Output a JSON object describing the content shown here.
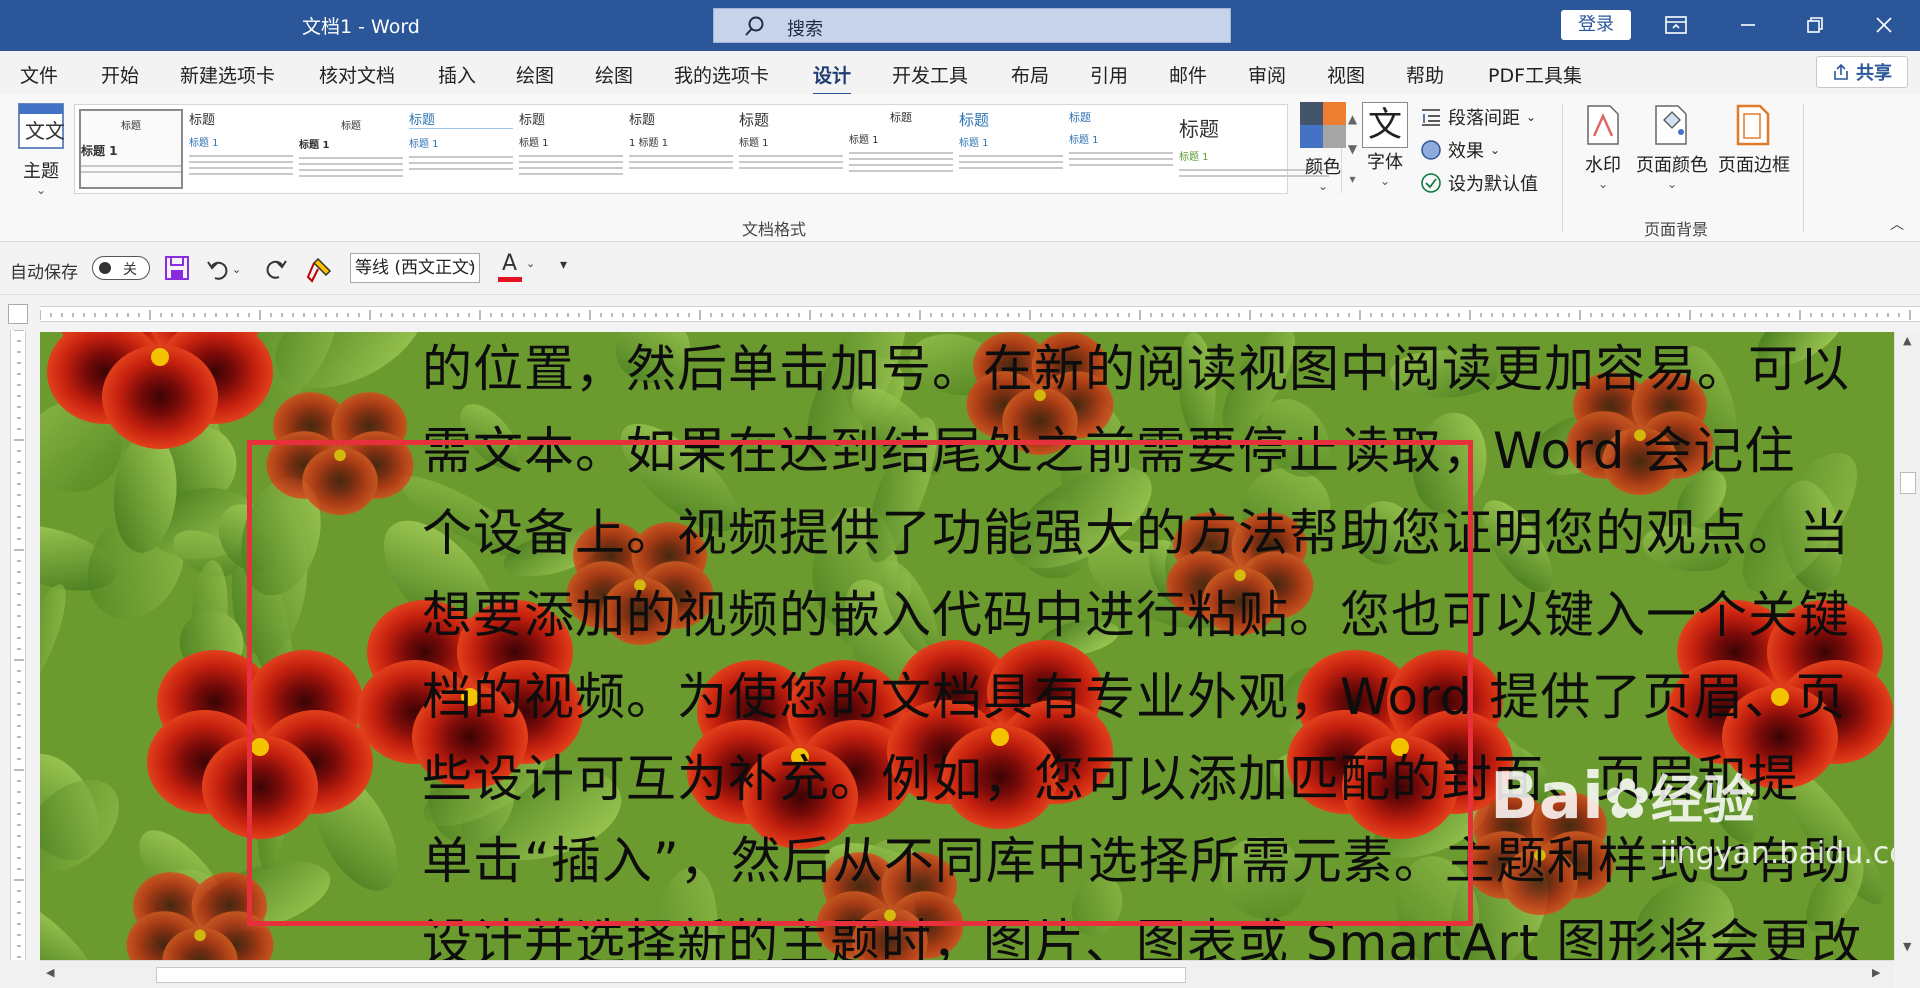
{
  "window": {
    "title": "文档1 - Word",
    "search_placeholder": "搜索",
    "login_label": "登录"
  },
  "tabs": [
    {
      "label": "文件"
    },
    {
      "label": "开始"
    },
    {
      "label": "新建选项卡"
    },
    {
      "label": "核对文档"
    },
    {
      "label": "插入"
    },
    {
      "label": "绘图"
    },
    {
      "label": "绘图"
    },
    {
      "label": "我的选项卡"
    },
    {
      "label": "设计",
      "active": true
    },
    {
      "label": "开发工具"
    },
    {
      "label": "布局"
    },
    {
      "label": "引用"
    },
    {
      "label": "邮件"
    },
    {
      "label": "审阅"
    },
    {
      "label": "视图"
    },
    {
      "label": "帮助"
    },
    {
      "label": "PDF工具集"
    }
  ],
  "share_label": "共享",
  "ribbon": {
    "theme_label": "主题",
    "gallery_items": [
      {
        "heading": "标题",
        "sub": "标题 1"
      },
      {
        "heading": "标题",
        "sub": "标题 1"
      },
      {
        "heading": "标题",
        "sub": "标题 1"
      },
      {
        "heading": "标题",
        "sub": "标题 1"
      },
      {
        "heading": "标题",
        "sub": "标题 1"
      },
      {
        "heading": "标题",
        "sub": "1 标题 1"
      },
      {
        "heading": "标题",
        "sub": "标题 1"
      },
      {
        "heading": "标题",
        "sub": "标题 1"
      },
      {
        "heading": "标题",
        "sub": "标题 1"
      },
      {
        "heading": "标题",
        "sub": "标题 1"
      },
      {
        "heading": "标题",
        "sub": "标题 1"
      }
    ],
    "doc_format_label": "文档格式",
    "colors_label": "颜色",
    "fonts_label": "字体",
    "para_spacing_label": "段落间距",
    "effects_label": "效果",
    "set_default_label": "设为默认值",
    "watermark_label": "水印",
    "page_color_label": "页面颜色",
    "page_border_label": "页面边框",
    "page_background_label": "页面背景"
  },
  "qat": {
    "autosave_label": "自动保存",
    "autosave_state": "关",
    "font_name": "等线 (西文正文)",
    "font_color_letter": "A"
  },
  "document": {
    "lines": [
      "的位置，然后单击加号。在新的阅读视图中阅读更加容易。可以",
      "需文本。如果在达到结尾处之前需要停止读取，Word 会记住",
      "个设备上。视频提供了功能强大的方法帮助您证明您的观点。当",
      "想要添加的视频的嵌入代码中进行粘贴。您也可以键入一个关键",
      "档的视频。为使您的文档具有专业外观，Word 提供了页眉、页",
      "些设计可互为补充。例如，您可以添加匹配的封面、页眉和提",
      "单击“插入”，然后从不同库中选择所需元素。主题和样式也有助",
      "设计并选择新的主题时，图片、图表或 SmartArt 图形将会更改"
    ],
    "watermark_logo": "Bai",
    "watermark_logo_suffix": "经验",
    "watermark_url": "jingyan.baidu.com"
  },
  "colors": {
    "brand": "#2b579a",
    "highlight_box": "#e8303d"
  }
}
